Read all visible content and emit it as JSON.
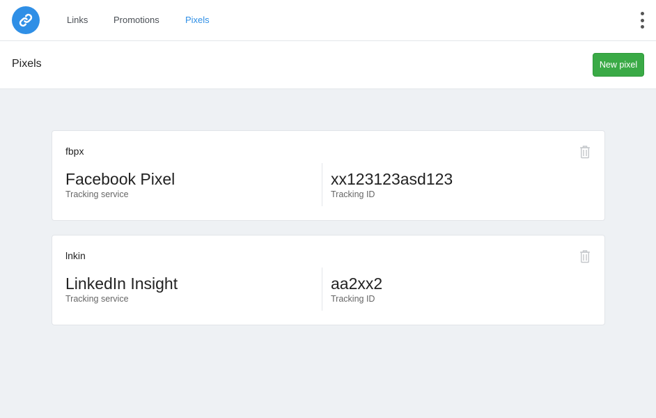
{
  "nav": {
    "items": [
      {
        "label": "Links"
      },
      {
        "label": "Promotions"
      },
      {
        "label": "Pixels",
        "active": true
      }
    ],
    "accent_color": "#2f8fe6"
  },
  "header": {
    "title": "Pixels",
    "new_button_label": "New pixel",
    "new_button_color": "#3aaa46"
  },
  "pixels": [
    {
      "key": "fbpx",
      "service": "Facebook Pixel",
      "service_label": "Tracking service",
      "tracking_id": "xx123123asd123",
      "tracking_id_label": "Tracking ID"
    },
    {
      "key": "lnkin",
      "service": "LinkedIn Insight",
      "service_label": "Tracking service",
      "tracking_id": "aa2xx2",
      "tracking_id_label": "Tracking ID"
    }
  ],
  "icons": {
    "logo": "link-icon",
    "menu": "more-vertical-icon",
    "delete": "trash-icon"
  }
}
